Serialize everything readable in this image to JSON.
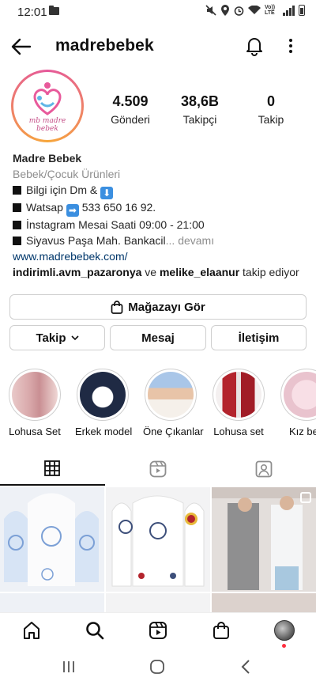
{
  "status_bar": {
    "time": "12:01",
    "network_label": "Vo)) LTE",
    "icons": [
      "folder-icon",
      "mute-icon",
      "location-icon",
      "alarm-icon",
      "wifi-icon",
      "signal-icon",
      "battery-icon"
    ]
  },
  "header": {
    "username": "madrebebek",
    "icons": [
      "back-arrow-icon",
      "bell-icon",
      "more-vertical-icon"
    ]
  },
  "profile": {
    "avatar_text": "mb madre bebek",
    "stats": [
      {
        "value": "4.509",
        "label": "Gönderi"
      },
      {
        "value": "38,6B",
        "label": "Takipçi"
      },
      {
        "value": "0",
        "label": "Takip"
      }
    ],
    "name": "Madre Bebek",
    "category": "Bebek/Çocuk Ürünleri",
    "bio_lines": [
      "Bilgi için Dm &",
      "Watsap",
      "İnstagram Mesai Saati 09:00 - 21:00",
      "Siyavus Paşa Mah. Bankacil"
    ],
    "bio_phone": "533 650 16 92.",
    "bio_more": "... devamı",
    "website": "www.madrebebek.com/",
    "followed_by": {
      "user1": "indirimli.avm_pazaronya",
      "connector": "ve",
      "user2": "melike_elaanur",
      "suffix": "takip ediyor"
    }
  },
  "actions": {
    "shop_label": "Mağazayı Gör",
    "follow_label": "Takip",
    "message_label": "Mesaj",
    "contact_label": "İletişim"
  },
  "highlights": [
    {
      "label": "Lohusa Set"
    },
    {
      "label": "Erkek model"
    },
    {
      "label": "Öne Çıkanlar"
    },
    {
      "label": "Lohusa set"
    },
    {
      "label": "Kız beb"
    }
  ],
  "tabs": [
    "grid-icon",
    "reels-icon",
    "tagged-icon"
  ],
  "bottom_nav": [
    "home-icon",
    "search-icon",
    "reels-icon",
    "shop-icon",
    "profile-avatar"
  ],
  "colors": {
    "accent_link": "#00376b",
    "story_ring_pink": "#e5589a",
    "story_ring_orange": "#f7a73b",
    "notification_dot": "#ff3040"
  }
}
